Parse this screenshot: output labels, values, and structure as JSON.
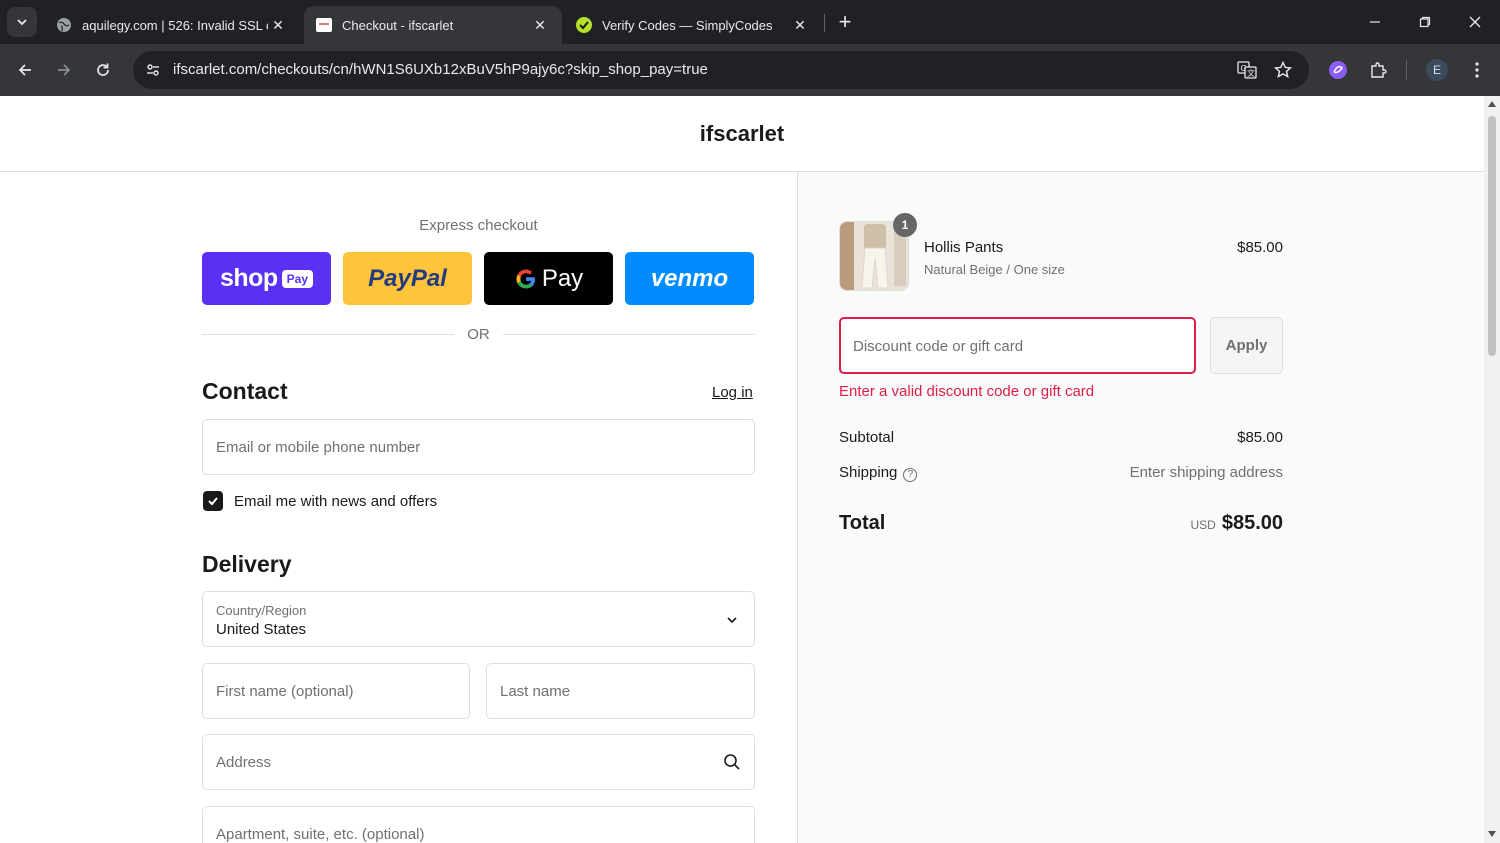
{
  "browser": {
    "tabs": [
      {
        "title": "aquilegy.com | 526: Invalid SSL c",
        "active": false
      },
      {
        "title": "Checkout - ifscarlet",
        "active": true
      },
      {
        "title": "Verify Codes — SimplyCodes",
        "active": false
      }
    ],
    "url": "ifscarlet.com/checkouts/cn/hWN1S6UXb12xBuV5hP9ajy6c?skip_shop_pay=true",
    "profile_initial": "E"
  },
  "header": {
    "store_name": "ifscarlet"
  },
  "express": {
    "label": "Express checkout",
    "buttons": [
      {
        "name": "shop Pay",
        "text": "shop",
        "badge": "Pay",
        "color": "#5a31f4"
      },
      {
        "name": "PayPal",
        "text": "PayPal",
        "color": "#ffc439"
      },
      {
        "name": "G Pay",
        "text": "Pay",
        "color": "#000000"
      },
      {
        "name": "venmo",
        "text": "venmo",
        "color": "#008cff"
      }
    ],
    "or_text": "OR"
  },
  "contact": {
    "title": "Contact",
    "login_label": "Log in",
    "email_placeholder": "Email or mobile phone number",
    "newsletter_label": "Email me with news and offers",
    "newsletter_checked": true
  },
  "delivery": {
    "title": "Delivery",
    "country_label": "Country/Region",
    "country_value": "United States",
    "first_name_placeholder": "First name (optional)",
    "last_name_placeholder": "Last name",
    "address_placeholder": "Address",
    "apartment_placeholder": "Apartment, suite, etc. (optional)"
  },
  "order": {
    "item": {
      "name": "Hollis Pants",
      "variant": "Natural Beige / One size",
      "price": "$85.00",
      "quantity": "1"
    },
    "discount_placeholder": "Discount code or gift card",
    "apply_label": "Apply",
    "discount_error": "Enter a valid discount code or gift card",
    "subtotal_label": "Subtotal",
    "subtotal_value": "$85.00",
    "shipping_label": "Shipping",
    "shipping_value": "Enter shipping address",
    "total_label": "Total",
    "total_currency": "USD",
    "total_value": "$85.00"
  },
  "colors": {
    "error": "#dd1d4a",
    "chrome_dark": "#202124",
    "chrome_toolbar": "#35363a"
  }
}
